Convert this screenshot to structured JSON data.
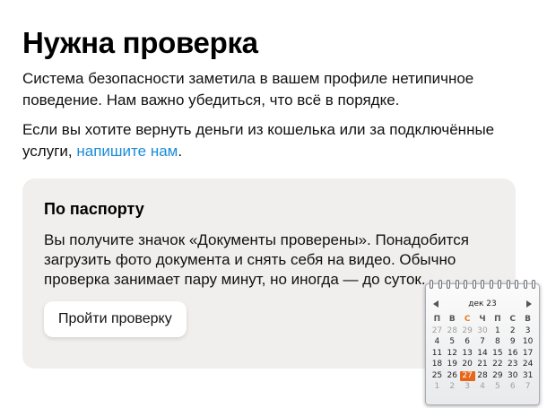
{
  "page": {
    "title": "Нужна проверка",
    "intro": "Система безопасности заметила в вашем профиле нетипичное поведение. Нам важно убедиться, что всё в порядке.",
    "refund_text": "Если вы хотите вернуть деньги из кошелька или за подключённые услуги, ",
    "refund_link": "напишите нам",
    "refund_end": "."
  },
  "card": {
    "title": "По паспорту",
    "text": "Вы получите значок «Документы проверены». Понадобится загрузить фото документа и снять себя на видео. Обычно проверка занимает пару минут, но иногда — до суток.",
    "button": "Пройти проверку"
  },
  "calendar": {
    "month": "дек 23",
    "weekdays": [
      "П",
      "В",
      "С",
      "Ч",
      "П",
      "С",
      "В"
    ],
    "highlight_weekday": 2,
    "today": 27,
    "accent": "#e8661a",
    "weeks": [
      [
        {
          "d": "27",
          "o": true
        },
        {
          "d": "28",
          "o": true
        },
        {
          "d": "29",
          "o": true
        },
        {
          "d": "30",
          "o": true
        },
        {
          "d": "1"
        },
        {
          "d": "2"
        },
        {
          "d": "3"
        }
      ],
      [
        {
          "d": "4"
        },
        {
          "d": "5"
        },
        {
          "d": "6"
        },
        {
          "d": "7"
        },
        {
          "d": "8"
        },
        {
          "d": "9"
        },
        {
          "d": "10"
        }
      ],
      [
        {
          "d": "11"
        },
        {
          "d": "12"
        },
        {
          "d": "13"
        },
        {
          "d": "14"
        },
        {
          "d": "15"
        },
        {
          "d": "16"
        },
        {
          "d": "17"
        }
      ],
      [
        {
          "d": "18"
        },
        {
          "d": "19"
        },
        {
          "d": "20"
        },
        {
          "d": "21"
        },
        {
          "d": "22"
        },
        {
          "d": "23"
        },
        {
          "d": "24"
        }
      ],
      [
        {
          "d": "25"
        },
        {
          "d": "26"
        },
        {
          "d": "27",
          "t": true
        },
        {
          "d": "28"
        },
        {
          "d": "29"
        },
        {
          "d": "30"
        },
        {
          "d": "31"
        }
      ],
      [
        {
          "d": "1",
          "o": true
        },
        {
          "d": "2",
          "o": true
        },
        {
          "d": "3",
          "o": true
        },
        {
          "d": "4",
          "o": true
        },
        {
          "d": "5",
          "o": true
        },
        {
          "d": "6",
          "o": true
        },
        {
          "d": "7",
          "o": true
        }
      ]
    ]
  }
}
